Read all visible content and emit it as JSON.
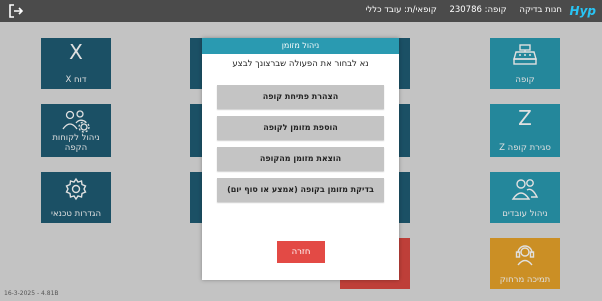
{
  "topbar": {
    "logo": "Hyp",
    "store": "חנות בדיקה",
    "register": "קופה: 230786",
    "cashier": "קופאי/ת: עובד כללי",
    "logout_icon": "logout-icon"
  },
  "tiles": {
    "x_report": {
      "label": "דוח X",
      "icon": "X"
    },
    "customers": {
      "label": "ניהול לקוחות הקפה",
      "icon": "users-gear-icon"
    },
    "tech_settings": {
      "label": "הגדרות טכנאי",
      "icon": "gear-icon"
    },
    "register": {
      "label": "קופה",
      "icon": "cash-register-icon"
    },
    "close_register": {
      "label": "סגירת קופה Z",
      "icon": "Z"
    },
    "employees": {
      "label": "ניהול עובדים",
      "icon": "users-icon"
    },
    "remote_support": {
      "label": "תמיכה מרחוק",
      "icon": "headset-icon"
    }
  },
  "modal": {
    "title": "ניהול מזומן",
    "subtitle": "נא לבחור את הפעולה שברצונך לבצע",
    "buttons": [
      {
        "label": "הצהרת פתיחת קופה"
      },
      {
        "label": "הוספת מזומן לקופה"
      },
      {
        "label": "הוצאת מזומן מהקופה"
      },
      {
        "label": "בדיקת מזומן בקופה (אמצע או סוף יום)"
      }
    ],
    "back": "חזרה"
  },
  "footer": {
    "version": "16-3-2025 - 4.81B"
  },
  "colors": {
    "navy": "#1f5c73",
    "teal": "#2a9ab1",
    "yellow": "#e8a32b",
    "red": "#e34a45",
    "topbar": "#4b4b4b"
  }
}
